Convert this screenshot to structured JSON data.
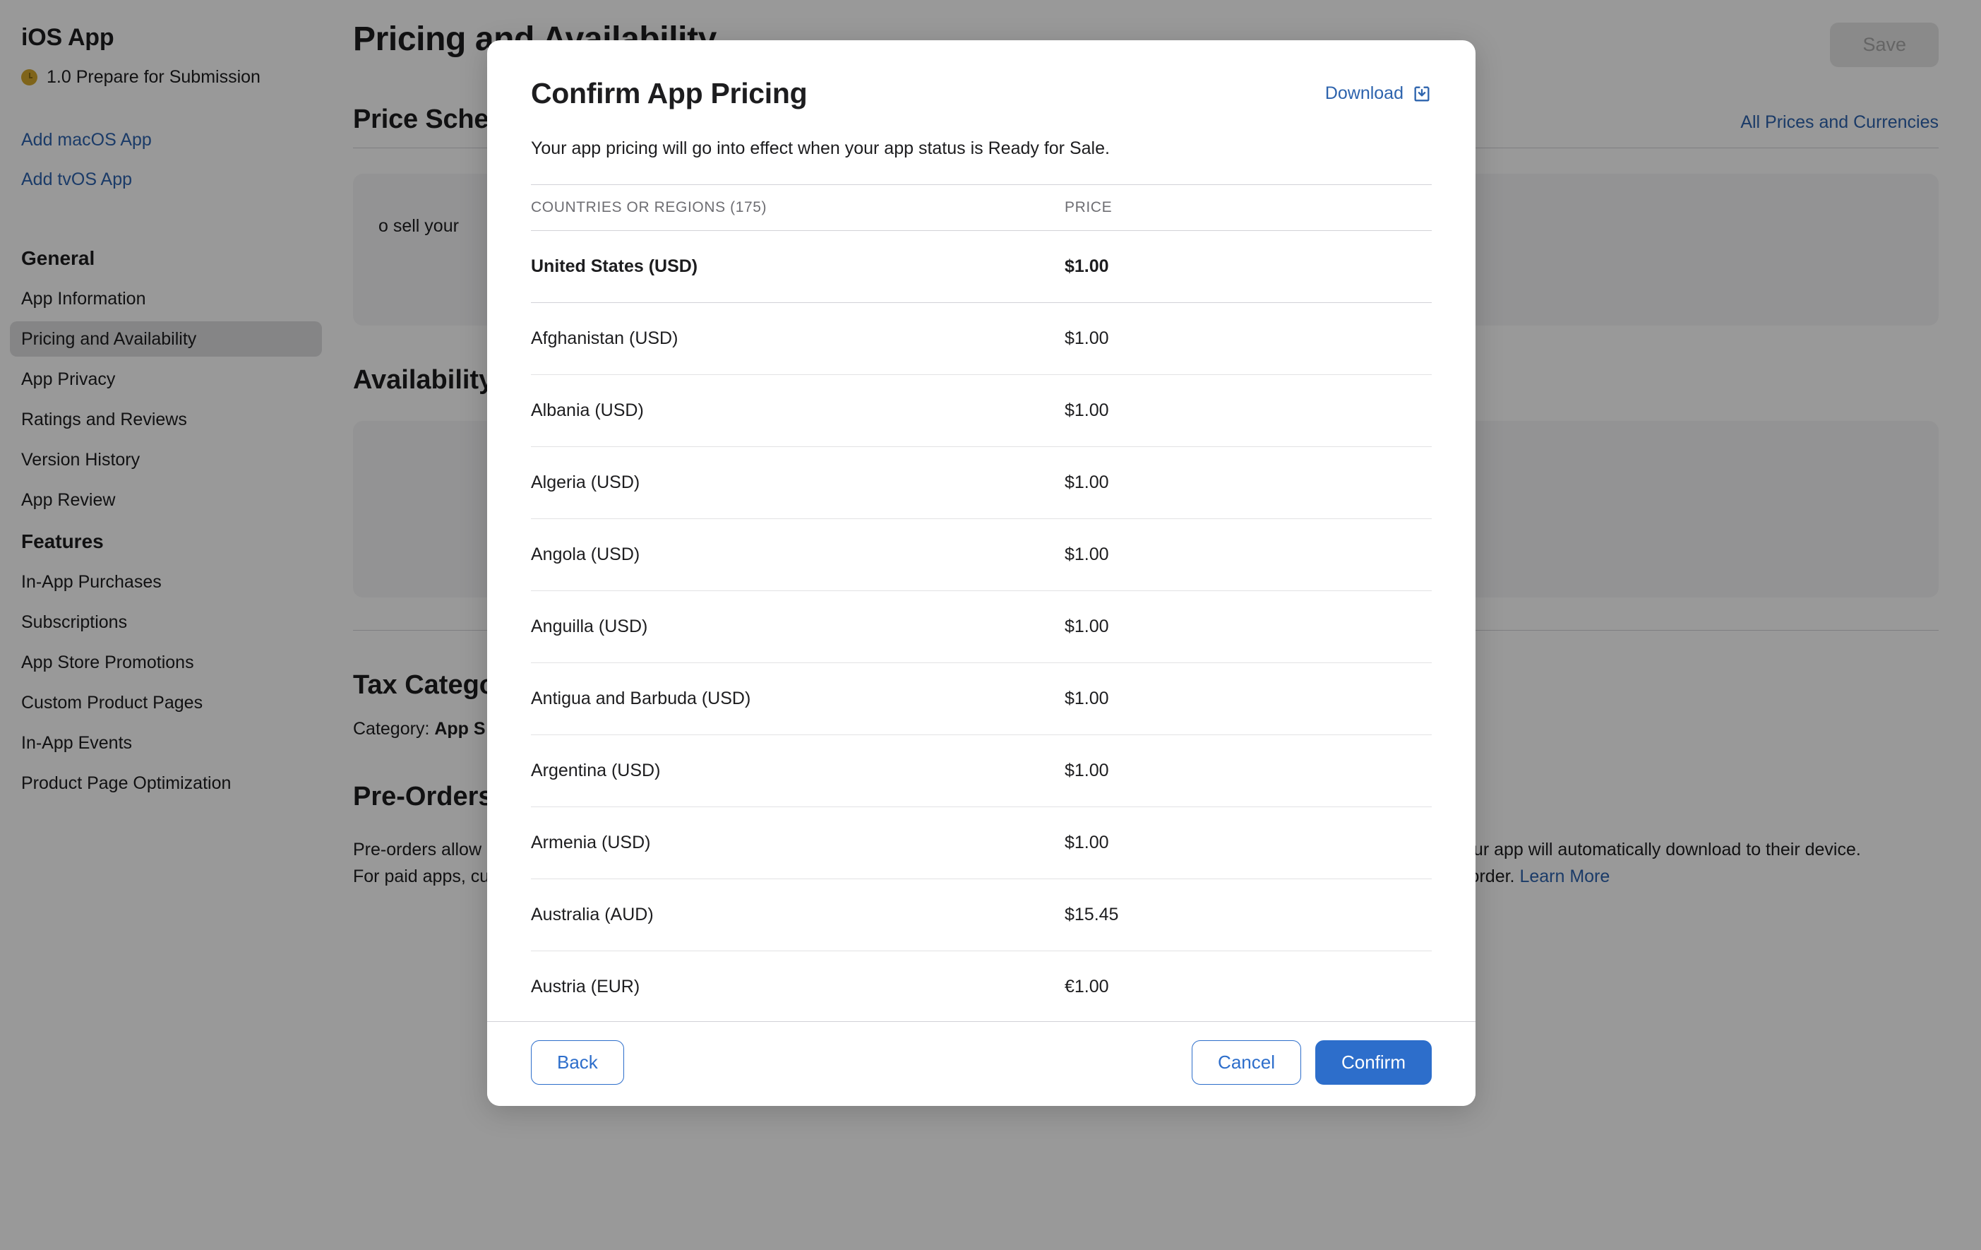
{
  "sidebar": {
    "app_kind": "iOS App",
    "status": "1.0 Prepare for Submission",
    "status_icon": "clock-icon",
    "links": [
      {
        "label": "Add macOS App"
      },
      {
        "label": "Add tvOS App"
      }
    ],
    "groups": [
      {
        "heading": "General",
        "items": [
          {
            "label": "App Information",
            "selected": false
          },
          {
            "label": "Pricing and Availability",
            "selected": true
          },
          {
            "label": "App Privacy",
            "selected": false
          },
          {
            "label": "Ratings and Reviews",
            "selected": false
          },
          {
            "label": "Version History",
            "selected": false
          },
          {
            "label": "App Review",
            "selected": false
          }
        ]
      },
      {
        "heading": "Features",
        "items": [
          {
            "label": "In-App Purchases",
            "selected": false
          },
          {
            "label": "Subscriptions",
            "selected": false
          },
          {
            "label": "App Store Promotions",
            "selected": false
          },
          {
            "label": "Custom Product Pages",
            "selected": false
          },
          {
            "label": "In-App Events",
            "selected": false
          },
          {
            "label": "Product Page Optimization",
            "selected": false
          }
        ]
      }
    ]
  },
  "main": {
    "page_title": "Pricing and Availability",
    "save_label": "Save",
    "price_schedule": {
      "title": "Price Schedule",
      "all_prices_link": "All Prices and Currencies",
      "panel_text": "o sell your"
    },
    "availability": {
      "title": "Availability"
    },
    "tax_category": {
      "title": "Tax Category",
      "label": "Category:",
      "value": "App S"
    },
    "pre_orders": {
      "title": "Pre-Orders",
      "body": "Pre-orders allow customers to order your app before its release date. Once your app is released for download, customers will be notified and your app will automatically download to their device. For paid apps, customers will be charged before download. Any app that hasn’t been published to the App Store can be made available for pre-order.",
      "learn_more": "Learn More"
    }
  },
  "modal": {
    "title": "Confirm App Pricing",
    "download_label": "Download",
    "download_icon": "download-tray-icon",
    "subtitle": "Your app pricing will go into effect when your app status is Ready for Sale.",
    "columns": {
      "country": "COUNTRIES OR REGIONS (175)",
      "price": "PRICE"
    },
    "rows": [
      {
        "country": "United States (USD)",
        "price": "$1.00",
        "primary": true
      },
      {
        "country": "Afghanistan (USD)",
        "price": "$1.00",
        "primary": false
      },
      {
        "country": "Albania (USD)",
        "price": "$1.00",
        "primary": false
      },
      {
        "country": "Algeria (USD)",
        "price": "$1.00",
        "primary": false
      },
      {
        "country": "Angola (USD)",
        "price": "$1.00",
        "primary": false
      },
      {
        "country": "Anguilla (USD)",
        "price": "$1.00",
        "primary": false
      },
      {
        "country": "Antigua and Barbuda (USD)",
        "price": "$1.00",
        "primary": false
      },
      {
        "country": "Argentina (USD)",
        "price": "$1.00",
        "primary": false
      },
      {
        "country": "Armenia (USD)",
        "price": "$1.00",
        "primary": false
      },
      {
        "country": "Australia (AUD)",
        "price": "$15.45",
        "primary": false
      },
      {
        "country": "Austria (EUR)",
        "price": "€1.00",
        "primary": false
      }
    ],
    "back_label": "Back",
    "cancel_label": "Cancel",
    "confirm_label": "Confirm"
  },
  "colors": {
    "link": "#2d63ad",
    "primary_button": "#2d6ecb",
    "status": "#d4a72c",
    "scrim": "rgba(0,0,0,0.40)"
  }
}
